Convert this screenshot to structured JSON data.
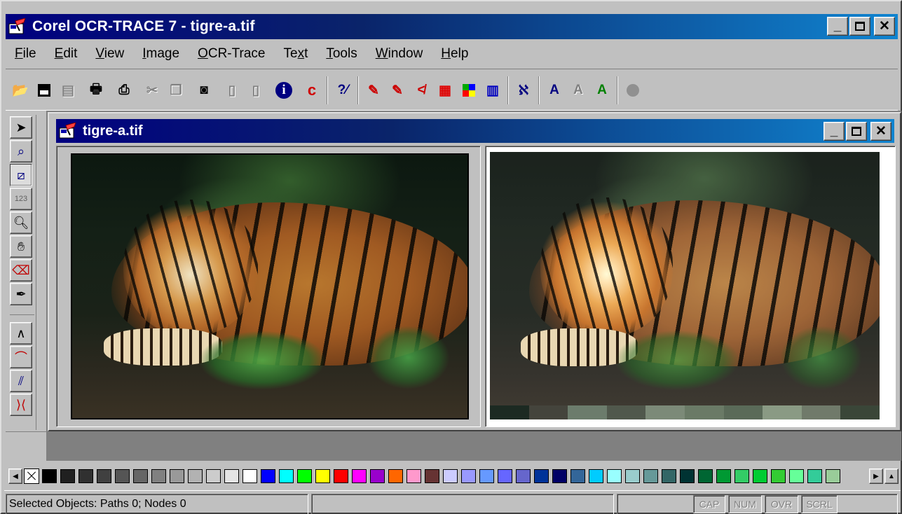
{
  "app": {
    "title": "Corel OCR-TRACE 7 - tigre-a.tif",
    "title_bar_color": "#000080"
  },
  "window_controls": {
    "minimize": "_",
    "maximize": "☐",
    "close": "✕"
  },
  "menu": [
    {
      "label": "File"
    },
    {
      "label": "Edit"
    },
    {
      "label": "View"
    },
    {
      "label": "Image"
    },
    {
      "label": "OCR-Trace"
    },
    {
      "label": "Text"
    },
    {
      "label": "Tools"
    },
    {
      "label": "Window"
    },
    {
      "label": "Help"
    }
  ],
  "toolbar_icons": [
    "open-icon",
    "save-icon",
    "save-as-icon",
    "print-icon",
    "scan-icon",
    "cut-icon",
    "copy-icon",
    "page-icon",
    "prev-page-icon",
    "next-page-icon",
    "info-icon",
    "corel-icon",
    "help-cursor-icon",
    "trace-outline-icon",
    "trace-centerline-icon",
    "trace-sketch-icon",
    "trace-mosaic-icon",
    "trace-color-icon",
    "trace-3d-icon",
    "ocr-icon",
    "ocr-text-icon",
    "ocr-gray-icon",
    "ocr-trace-icon",
    "record-icon"
  ],
  "tools": [
    "pick-tool-icon",
    "magic-wand-icon",
    "pencil-tool-icon",
    "ocr-area-icon",
    "zoom-icon",
    "hand-icon",
    "eraser-icon",
    "pen-icon",
    "shape-tool-icon",
    "curve-tool-icon",
    "bezier-icon",
    "node-icon"
  ],
  "document": {
    "title": "tigre-a.tif",
    "left_pane": "original",
    "right_pane": "traced"
  },
  "palette": {
    "colors": [
      "#000000",
      "#202020",
      "#303030",
      "#404040",
      "#555555",
      "#666666",
      "#808080",
      "#999999",
      "#b2b2b2",
      "#cccccc",
      "#e5e5e5",
      "#ffffff",
      "#0000ff",
      "#00ffff",
      "#00ff00",
      "#ffff00",
      "#ff0000",
      "#ff00ff",
      "#9900cc",
      "#ff6600",
      "#ff99cc",
      "#663333",
      "#ccccff",
      "#9999ff",
      "#6699ff",
      "#6666ff",
      "#6666cc",
      "#003399",
      "#000066",
      "#336699",
      "#00ccff",
      "#99ffff",
      "#99cccc",
      "#669999",
      "#336666",
      "#003333",
      "#006633",
      "#009933",
      "#33cc66",
      "#00cc33",
      "#33cc33",
      "#66ff99",
      "#33cc99",
      "#99cc99"
    ]
  },
  "traced_swatches": [
    "#1c2a22",
    "#44443c",
    "#6c7c6c",
    "#50584c",
    "#7c8a78",
    "#6a7a66",
    "#5a6a58",
    "#8a9a84",
    "#707a6a",
    "#3a4638"
  ],
  "statusbar": {
    "text": "Selected Objects: Paths 0; Nodes 0",
    "keys": [
      "CAP",
      "NUM",
      "OVR",
      "SCRL"
    ]
  }
}
